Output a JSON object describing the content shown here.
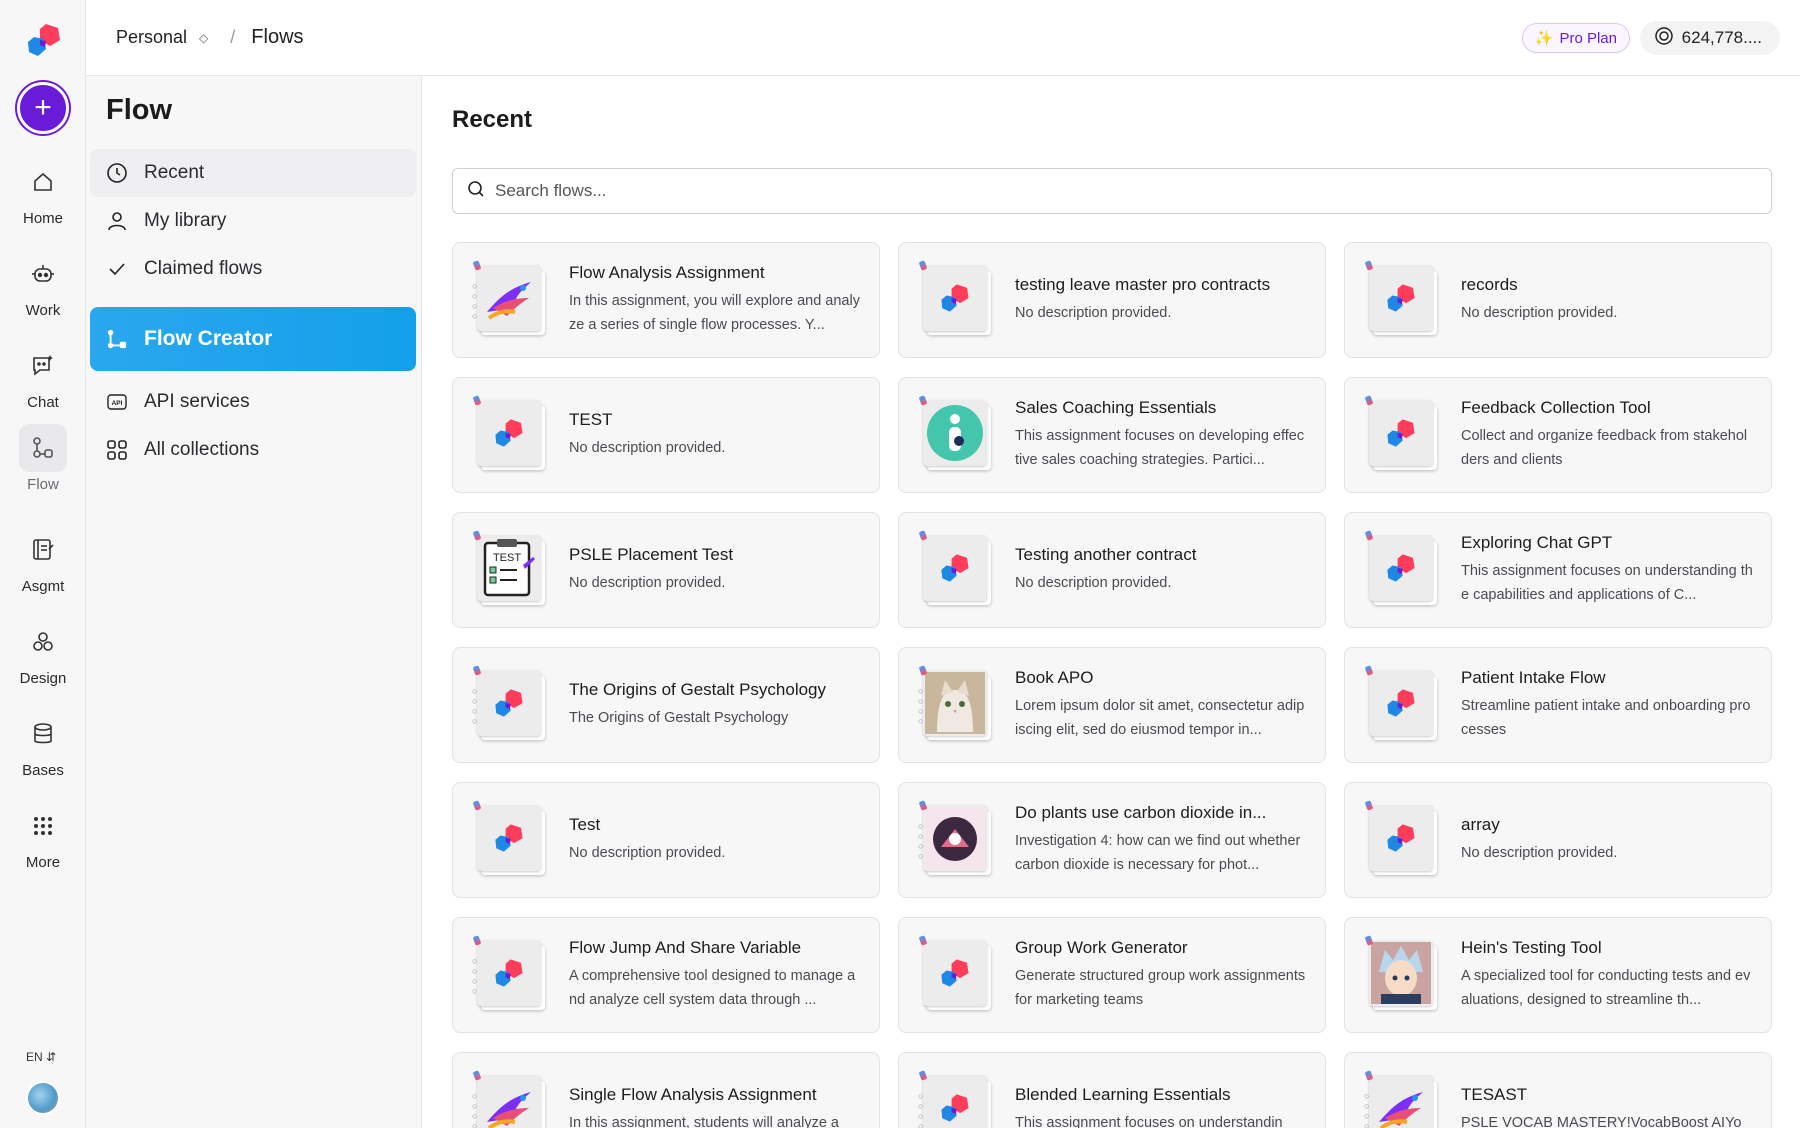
{
  "rail": {
    "items": [
      {
        "label": "Home",
        "icon": "home-icon"
      },
      {
        "label": "Work",
        "icon": "robot-icon"
      },
      {
        "label": "Chat",
        "icon": "chat-icon"
      },
      {
        "label": "Flow",
        "icon": "flow-icon"
      },
      {
        "label": "Asgmt",
        "icon": "assignment-icon"
      },
      {
        "label": "Design",
        "icon": "design-icon"
      },
      {
        "label": "Bases",
        "icon": "database-icon"
      },
      {
        "label": "More",
        "icon": "grid-dots-icon"
      }
    ],
    "active": "Flow",
    "lang": "EN"
  },
  "topbar": {
    "workspace": "Personal",
    "separator": "/",
    "current": "Flows",
    "plan": "Pro Plan",
    "credits": "624,778...."
  },
  "sidebar": {
    "title": "Flow",
    "items": [
      {
        "label": "Recent",
        "icon": "clock-icon"
      },
      {
        "label": "My library",
        "icon": "user-icon"
      },
      {
        "label": "Claimed flows",
        "icon": "check-icon"
      },
      {
        "label": "Flow Creator",
        "icon": "flow-creator-icon"
      },
      {
        "label": "API services",
        "icon": "api-icon"
      },
      {
        "label": "All collections",
        "icon": "collections-icon"
      }
    ]
  },
  "main": {
    "title": "Recent",
    "search_placeholder": "Search flows...",
    "cards": [
      {
        "title": "Flow Analysis Assignment",
        "desc": "In this assignment, you will explore and analyze a series of single flow processes. Y...",
        "thumb": "bird"
      },
      {
        "title": "testing leave master pro contracts",
        "desc": "No description provided.",
        "thumb": "logo"
      },
      {
        "title": "records",
        "desc": "No description provided.",
        "thumb": "logo"
      },
      {
        "title": "TEST",
        "desc": "No description provided.",
        "thumb": "logo"
      },
      {
        "title": "Sales Coaching Essentials",
        "desc": "This assignment focuses on developing effective sales coaching strategies. Partici...",
        "thumb": "teal"
      },
      {
        "title": "Feedback Collection Tool",
        "desc": "Collect and organize feedback from stakeholders and clients",
        "thumb": "logo"
      },
      {
        "title": "PSLE Placement Test",
        "desc": "No description provided.",
        "thumb": "test"
      },
      {
        "title": "Testing another contract",
        "desc": "No description provided.",
        "thumb": "logo"
      },
      {
        "title": "Exploring Chat GPT",
        "desc": "This assignment focuses on understanding the capabilities and applications of C...",
        "thumb": "logo"
      },
      {
        "title": "The Origins of Gestalt Psychology",
        "desc": "The Origins of Gestalt Psychology",
        "thumb": "logo-rings"
      },
      {
        "title": "Book APO",
        "desc": "Lorem ipsum dolor sit amet, consectetur adipiscing elit, sed do eiusmod tempor in...",
        "thumb": "cat"
      },
      {
        "title": "Patient Intake Flow",
        "desc": "Streamline patient intake and onboarding processes",
        "thumb": "logo"
      },
      {
        "title": "Test",
        "desc": "No description provided.",
        "thumb": "logo"
      },
      {
        "title": "Do plants use carbon dioxide in...",
        "desc": "Investigation 4: how can we find out whether carbon dioxide is necessary for phot...",
        "thumb": "plant"
      },
      {
        "title": "array",
        "desc": "No description provided.",
        "thumb": "logo"
      },
      {
        "title": "Flow Jump And Share Variable",
        "desc": "A comprehensive tool designed to manage and analyze cell system data through ...",
        "thumb": "logo-rings"
      },
      {
        "title": "Group Work Generator",
        "desc": "Generate structured group work assignments for marketing teams",
        "thumb": "logo"
      },
      {
        "title": "Hein's Testing Tool",
        "desc": "A specialized tool for conducting tests and evaluations, designed to streamline th...",
        "thumb": "anime"
      },
      {
        "title": "Single Flow Analysis Assignment",
        "desc": "In this assignment, students will analyze a",
        "thumb": "bird"
      },
      {
        "title": "Blended Learning Essentials",
        "desc": "This assignment focuses on understandin",
        "thumb": "logo-rings"
      },
      {
        "title": "TESAST",
        "desc": "PSLE VOCAB MASTERY!VocabBoost AIYo",
        "thumb": "bird"
      }
    ]
  }
}
